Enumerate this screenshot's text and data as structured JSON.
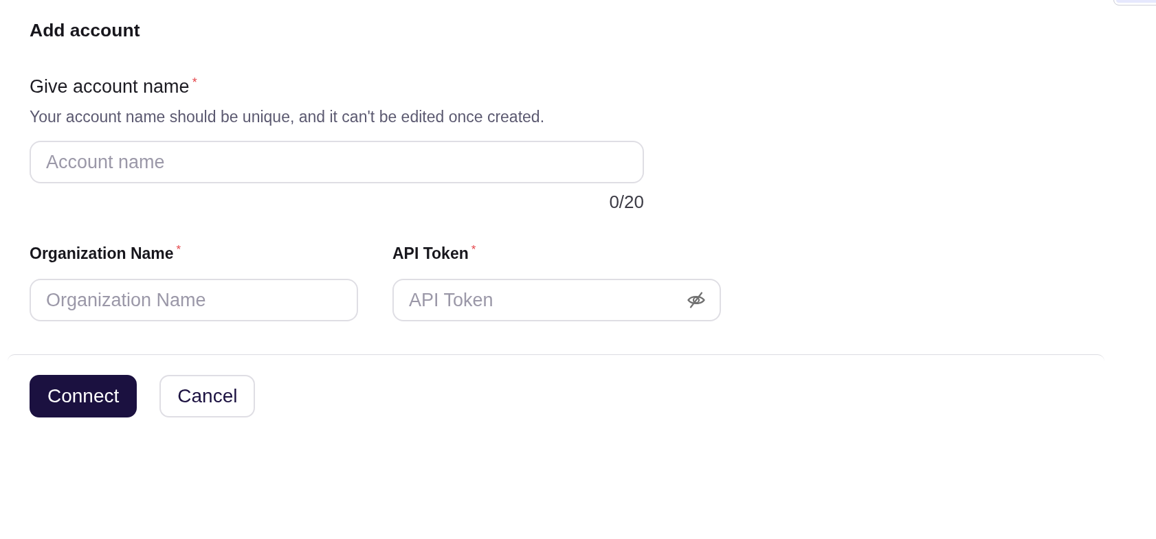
{
  "title": "Add account",
  "account_name": {
    "label": "Give account name",
    "required_mark": "*",
    "hint": "Your account name should be unique, and it can't be edited once created.",
    "placeholder": "Account name",
    "counter": "0/20"
  },
  "fields": [
    {
      "label": "Organization Name",
      "required_mark": "*",
      "placeholder": "Organization Name",
      "kind": "text"
    },
    {
      "label": "API Token",
      "required_mark": "*",
      "placeholder": "API Token",
      "kind": "password"
    }
  ],
  "buttons": [
    {
      "label": "Connect",
      "kind": "primary"
    },
    {
      "label": "Cancel",
      "kind": "secondary"
    }
  ]
}
